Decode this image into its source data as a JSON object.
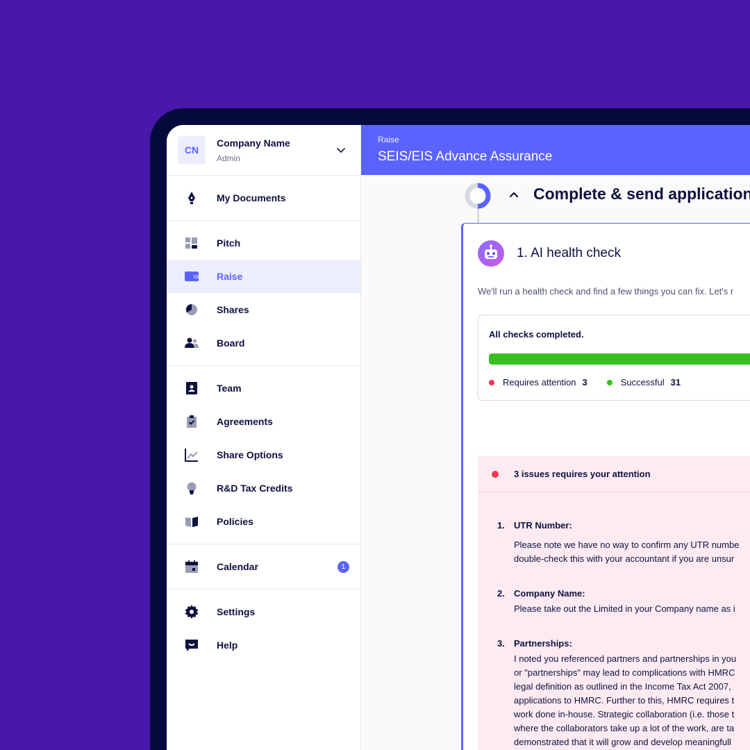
{
  "sidebar": {
    "company": {
      "initials": "CN",
      "name": "Company Name",
      "role": "Admin"
    },
    "groups": [
      [
        {
          "label": "My Documents",
          "icon": "pen-nib-icon"
        }
      ],
      [
        {
          "label": "Pitch",
          "icon": "pitch-blocks-icon"
        },
        {
          "label": "Raise",
          "icon": "wallet-icon",
          "active": true
        },
        {
          "label": "Shares",
          "icon": "pie-chart-icon"
        },
        {
          "label": "Board",
          "icon": "people-icon"
        }
      ],
      [
        {
          "label": "Team",
          "icon": "id-badge-icon"
        },
        {
          "label": "Agreements",
          "icon": "clipboard-check-icon"
        },
        {
          "label": "Share Options",
          "icon": "line-chart-icon"
        },
        {
          "label": "R&D Tax Credits",
          "icon": "lightbulb-icon"
        },
        {
          "label": "Policies",
          "icon": "book-icon"
        }
      ],
      [
        {
          "label": "Calendar",
          "icon": "calendar-icon",
          "badge": "1"
        }
      ],
      [
        {
          "label": "Settings",
          "icon": "gear-icon"
        },
        {
          "label": "Help",
          "icon": "chat-smile-icon"
        }
      ]
    ]
  },
  "header": {
    "breadcrumb": "Raise",
    "title": "SEIS/EIS Advance Assurance"
  },
  "step": {
    "title": "Complete & send application"
  },
  "card": {
    "title": "1. AI health check",
    "description": "We'll run a health check and find a few things you can fix. Let's r",
    "checks": {
      "title": "All checks completed.",
      "progress": 1.0,
      "attention_label": "Requires attention",
      "attention_count": "3",
      "success_label": "Successful",
      "success_count": "31"
    },
    "issues": {
      "header": "3 issues requires your attention",
      "items": [
        {
          "num": "1.",
          "title": "UTR Number:",
          "lines": [
            "Please note we have no way to confirm any UTR numbe",
            "double-check this with your accountant if you are unsur"
          ]
        },
        {
          "num": "2.",
          "title": "Company Name:",
          "lines": [
            "Please take out the Limited in your Company name as i"
          ]
        },
        {
          "num": "3.",
          "title": "Partnerships:",
          "lines": [
            "I noted you referenced partners and partnerships in you",
            "or \"partnerships\" may lead to complications with HMRC",
            "legal definition as outlined in the Income Tax Act 2007,",
            "applications to HMRC. Further to this, HMRC requires t",
            "work done in-house. Strategic collaboration (i.e. those t",
            "where the collaborators take up a lot of the work, are ta",
            "demonstrated that it will grow and develop meaningfull"
          ]
        }
      ]
    }
  },
  "colors": {
    "background": "#4a17ab",
    "accent": "#5b63ff",
    "success": "#37c01e",
    "danger": "#f0384f",
    "issues_bg": "#fdebf1"
  }
}
